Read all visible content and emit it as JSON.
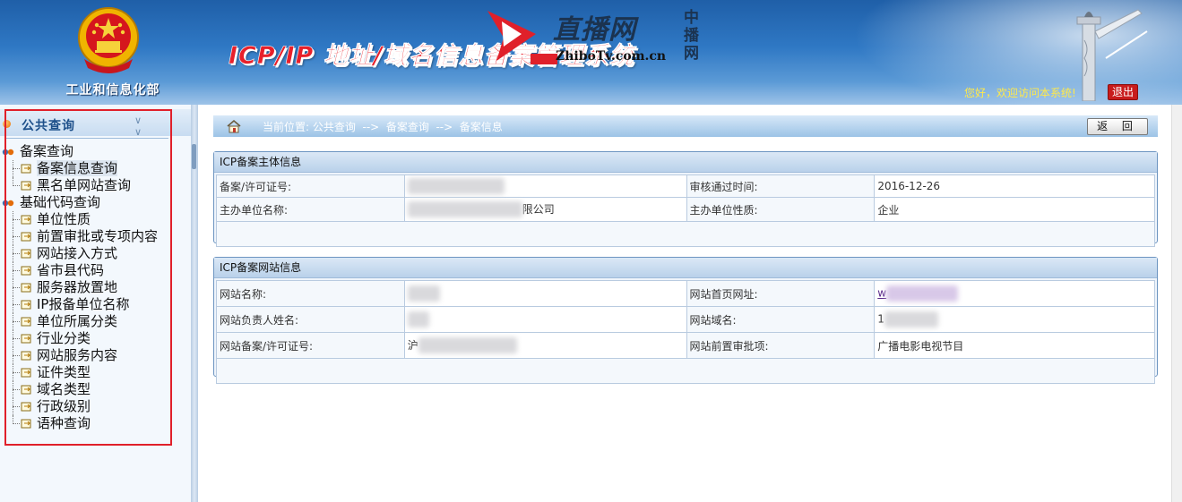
{
  "header": {
    "ministry": "工业和信息化部",
    "system_title": "ICP/IP 地址/域名信息备案管理系统",
    "watermark": {
      "name": "直播网",
      "url": "ZhiboTv.com.cn",
      "side_chars": "中播网"
    },
    "welcome": "您好，欢迎访问本系统!",
    "logout_label": "退出"
  },
  "sidebar": {
    "title": "公共查询",
    "collapse_icon": "double-chevron-down-icon",
    "groups": [
      {
        "label": "备案查询",
        "items": [
          "备案信息查询",
          "黑名单网站查询"
        ]
      },
      {
        "label": "基础代码查询",
        "items": [
          "单位性质",
          "前置审批或专项内容",
          "网站接入方式",
          "省市县代码",
          "服务器放置地",
          "IP报备单位名称",
          "单位所属分类",
          "行业分类",
          "网站服务内容",
          "证件类型",
          "域名类型",
          "行政级别",
          "语种查询"
        ]
      }
    ]
  },
  "breadcrumb": {
    "text": "当前位置: 公共查询  -->  备案查询  -->  备案信息",
    "back_label": "返 回"
  },
  "panel1": {
    "title": "ICP备案主体信息",
    "rows": [
      {
        "label1": "备案/许可证号:",
        "value1": "",
        "label2": "审核通过时间:",
        "value2": "2016-12-26"
      },
      {
        "label1": "主办单位名称:",
        "value1": "限公司",
        "label2": "主办单位性质:",
        "value2": "企业"
      }
    ]
  },
  "panel2": {
    "title": "ICP备案网站信息",
    "rows": [
      {
        "label1": "网站名称:",
        "value1": "",
        "label2": "网站首页网址:",
        "value2": "w"
      },
      {
        "label1": "网站负责人姓名:",
        "value1": "",
        "label2": "网站域名:",
        "value2": "1"
      },
      {
        "label1": "网站备案/许可证号:",
        "value1": "沪",
        "label2": "网站前置审批项:",
        "value2": "广播电影电视节目"
      }
    ]
  },
  "colors": {
    "accent": "#e0202a",
    "header_blue": "#2f78c4",
    "panel_border": "#6d95c1"
  }
}
